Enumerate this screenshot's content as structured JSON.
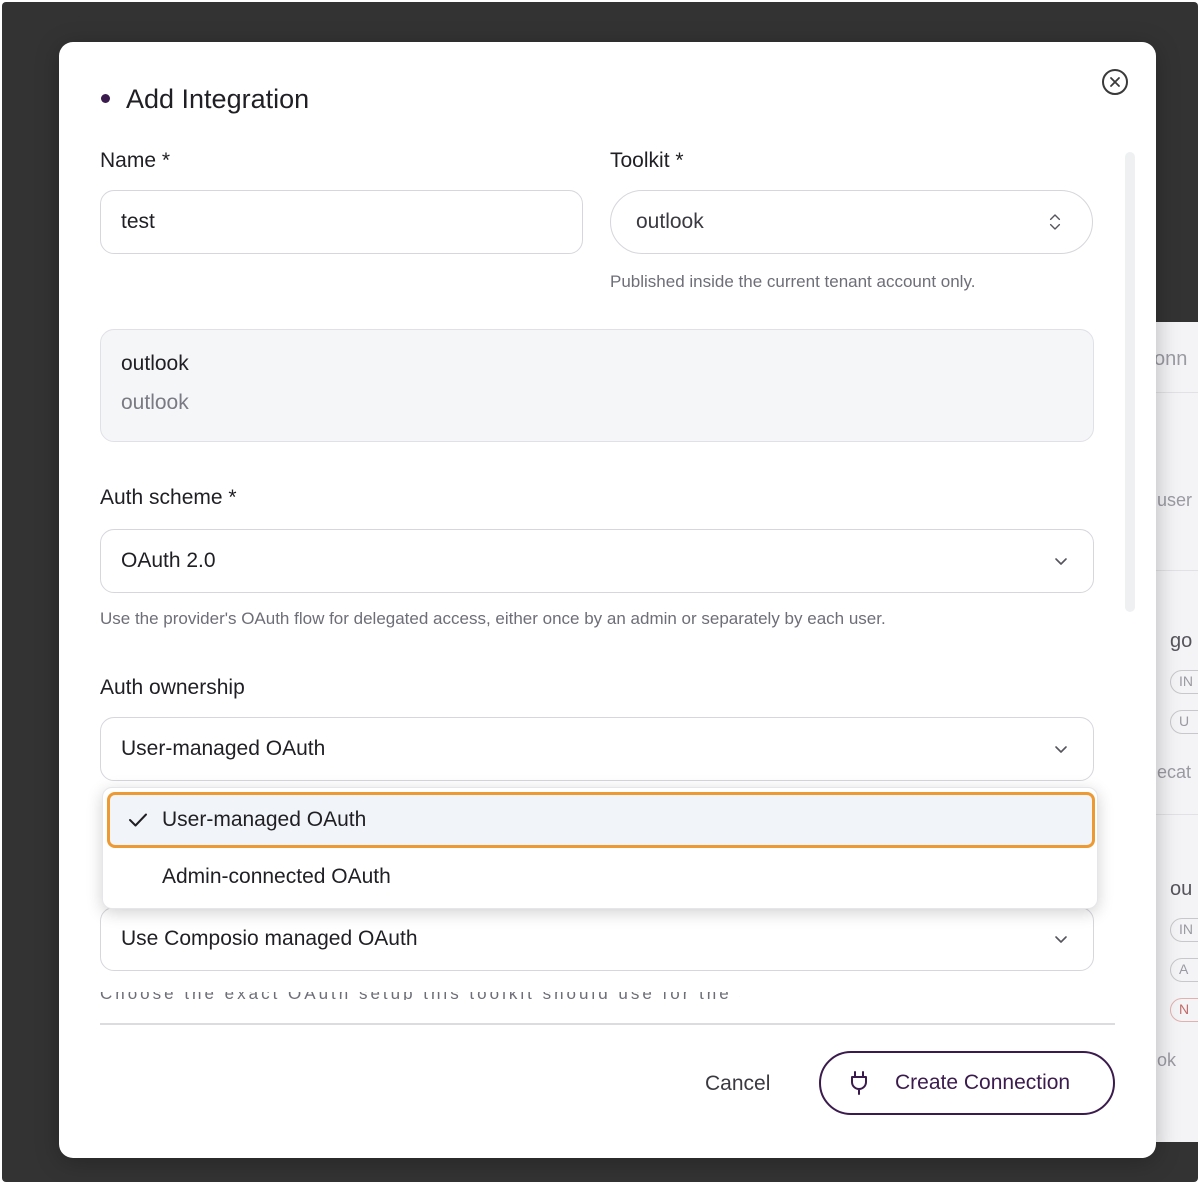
{
  "background": {
    "texts": [
      "onn",
      "user",
      "go",
      "IN",
      "U",
      "ecat",
      "ou",
      "IN",
      "A",
      "N",
      "ok"
    ]
  },
  "modal": {
    "title": "Add Integration",
    "name_label": "Name *",
    "name_value": "test",
    "toolkit_label": "Toolkit *",
    "toolkit_value": "outlook",
    "toolkit_help": "Published inside the current tenant account only.",
    "toolkit_card": {
      "title": "outlook",
      "subtitle": "outlook"
    },
    "auth_scheme_label": "Auth scheme *",
    "auth_scheme_value": "OAuth 2.0",
    "auth_scheme_help": "Use the provider's OAuth flow for delegated access, either once by an admin or separately by each user.",
    "auth_ownership_label": "Auth ownership",
    "auth_ownership_value": "User-managed OAuth",
    "auth_ownership_options": [
      "User-managed OAuth",
      "Admin-connected OAuth"
    ],
    "oauth_app_value": "Use Composio managed OAuth",
    "oauth_app_help": "Choose the exact OAuth setup this toolkit should use for the selected toolkit.",
    "cancel_label": "Cancel",
    "create_label": "Create Connection"
  },
  "colors": {
    "accent": "#3b1b4d",
    "highlight": "#ee9a32",
    "backdrop": "#333333"
  }
}
